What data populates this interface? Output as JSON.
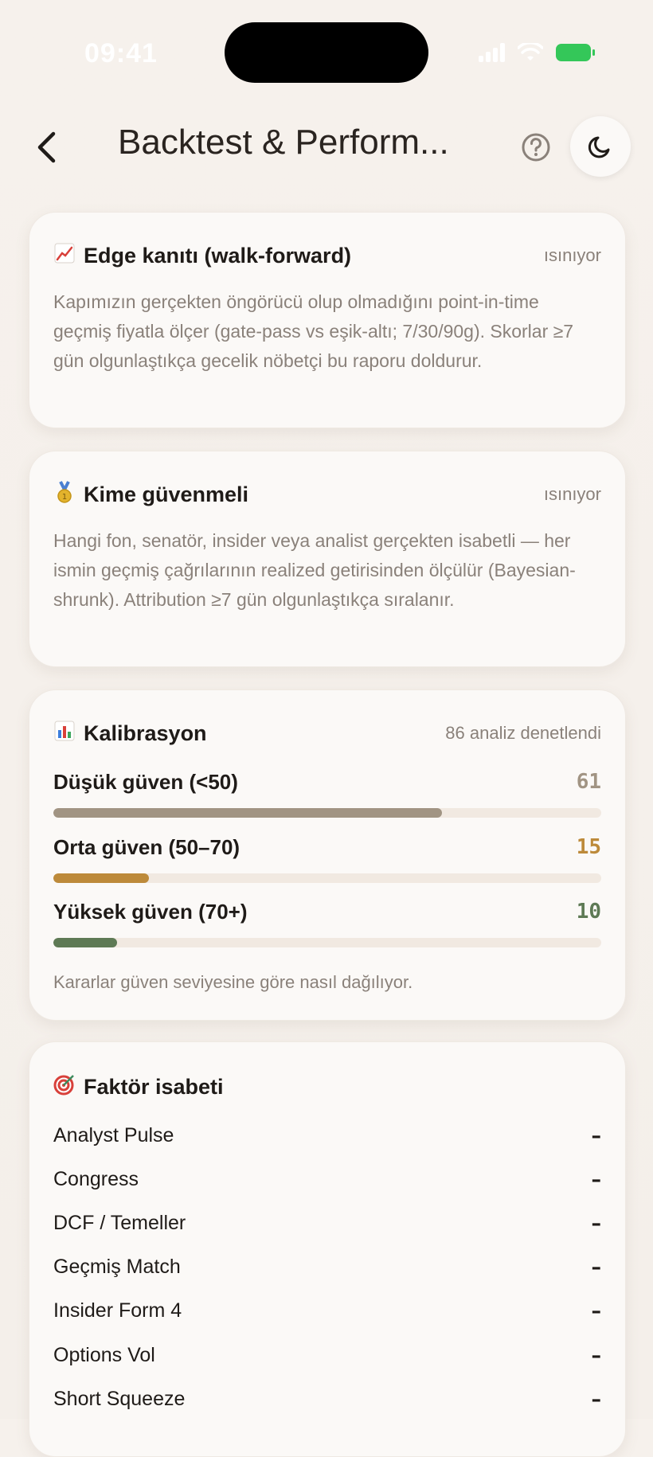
{
  "status": {
    "time": "09:41"
  },
  "nav": {
    "title": "Backtest & Perform..."
  },
  "colors": {
    "accent_low": "#a19483",
    "accent_mid": "#bd8a3a",
    "accent_high": "#5e7a55",
    "muted": "#8a817a"
  },
  "edge": {
    "icon": "chart-up-icon",
    "title": "Edge kanıtı (walk-forward)",
    "meta": "ısınıyor",
    "desc": "Kapımızın gerçekten öngörücü olup olmadığını point-in-time geçmiş fiyatla ölçer (gate-pass vs eşik-altı; 7/30/90g). Skorlar ≥7 gün olgunlaştıkça gecelik nöbetçi bu raporu doldurur."
  },
  "trust": {
    "icon": "medal-icon",
    "title": "Kime güvenmeli",
    "meta": "ısınıyor",
    "desc": "Hangi fon, senatör, insider veya analist gerçekten isabetli — her ismin geçmiş çağrılarının realized getirisinden ölçülür (Bayesian-shrunk). Attribution ≥7 gün olgunlaştıkça sıralanır."
  },
  "calibration": {
    "icon": "bar-chart-icon",
    "title": "Kalibrasyon",
    "meta": "86 analiz denetlendi",
    "rows": [
      {
        "label": "Düşük güven (<50)",
        "value": "61",
        "fraction": 0.709,
        "color": "#a19483"
      },
      {
        "label": "Orta güven (50–70)",
        "value": "15",
        "fraction": 0.174,
        "color": "#bd8a3a"
      },
      {
        "label": "Yüksek güven (70+)",
        "value": "10",
        "fraction": 0.116,
        "color": "#5e7a55"
      }
    ],
    "note": "Kararlar güven seviyesine göre nasıl dağılıyor."
  },
  "factors": {
    "icon": "target-icon",
    "title": "Faktör isabeti",
    "items": [
      {
        "name": "Analyst Pulse",
        "value": "–"
      },
      {
        "name": "Congress",
        "value": "–"
      },
      {
        "name": "DCF / Temeller",
        "value": "–"
      },
      {
        "name": "Geçmiş Match",
        "value": "–"
      },
      {
        "name": "Insider Form 4",
        "value": "–"
      },
      {
        "name": "Options Vol",
        "value": "–"
      },
      {
        "name": "Short Squeeze",
        "value": "–"
      }
    ]
  }
}
